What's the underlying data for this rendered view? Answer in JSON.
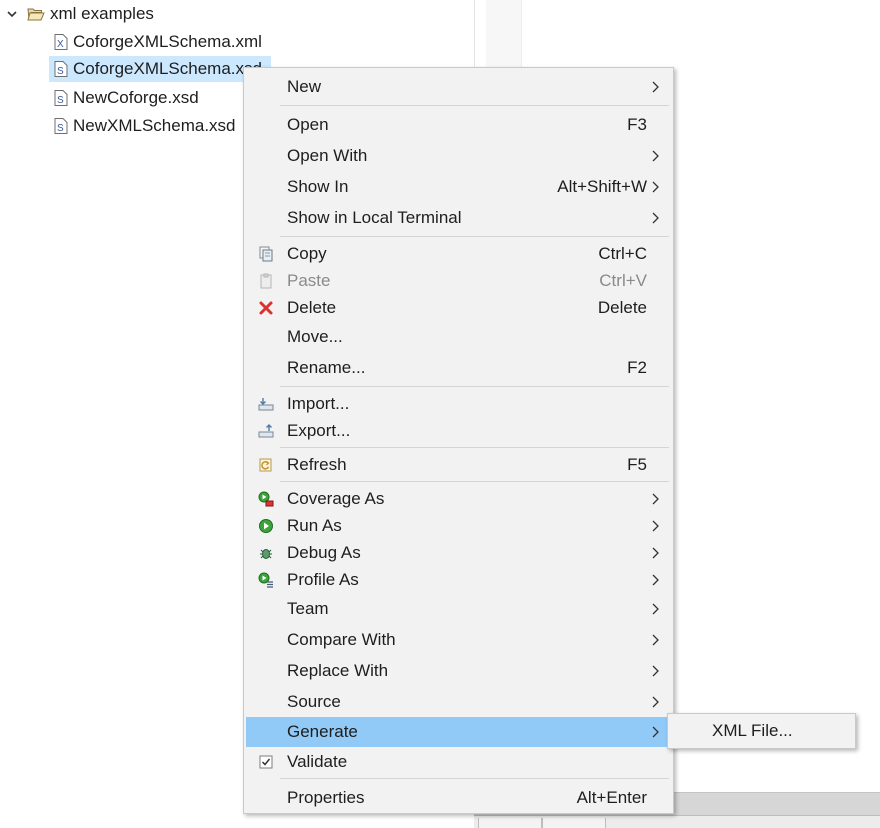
{
  "tree": {
    "folder": "xml examples",
    "files": [
      {
        "name": "CoforgeXMLSchema.xml",
        "icon": "xml-file-icon",
        "selected": false
      },
      {
        "name": "CoforgeXMLSchema.xsd",
        "icon": "xsd-file-icon",
        "selected": true
      },
      {
        "name": "NewCoforge.xsd",
        "icon": "xsd-file-icon",
        "selected": false
      },
      {
        "name": "NewXMLSchema.xsd",
        "icon": "xsd-file-icon",
        "selected": false
      }
    ]
  },
  "menu": {
    "items": [
      {
        "label": "New",
        "submenu": true
      },
      {
        "label": "Open",
        "shortcut": "F3"
      },
      {
        "label": "Open With",
        "submenu": true
      },
      {
        "label": "Show In",
        "shortcut": "Alt+Shift+W",
        "submenu": true
      },
      {
        "label": "Show in Local Terminal",
        "submenu": true
      },
      {
        "label": "Copy",
        "shortcut": "Ctrl+C",
        "icon": "copy-icon"
      },
      {
        "label": "Paste",
        "shortcut": "Ctrl+V",
        "icon": "paste-icon",
        "disabled": true
      },
      {
        "label": "Delete",
        "shortcut": "Delete",
        "icon": "delete-icon"
      },
      {
        "label": "Move..."
      },
      {
        "label": "Rename...",
        "shortcut": "F2"
      },
      {
        "label": "Import...",
        "icon": "import-icon"
      },
      {
        "label": "Export...",
        "icon": "export-icon"
      },
      {
        "label": "Refresh",
        "shortcut": "F5",
        "icon": "refresh-icon"
      },
      {
        "label": "Coverage As",
        "icon": "coverage-icon",
        "submenu": true
      },
      {
        "label": "Run As",
        "icon": "run-icon",
        "submenu": true
      },
      {
        "label": "Debug As",
        "icon": "debug-icon",
        "submenu": true
      },
      {
        "label": "Profile As",
        "icon": "profile-icon",
        "submenu": true
      },
      {
        "label": "Team",
        "submenu": true
      },
      {
        "label": "Compare With",
        "submenu": true
      },
      {
        "label": "Replace With",
        "submenu": true
      },
      {
        "label": "Source",
        "submenu": true
      },
      {
        "label": "Generate",
        "submenu": true,
        "highlighted": true
      },
      {
        "label": "Validate",
        "icon": "checkbox-icon",
        "checked": true
      },
      {
        "label": "Properties",
        "shortcut": "Alt+Enter"
      }
    ]
  },
  "submenu": {
    "items": [
      {
        "label": "XML File..."
      }
    ]
  },
  "colors": {
    "highlight": "#91c9f7",
    "selection": "#cce8ff",
    "menu_bg": "#f2f2f2"
  }
}
